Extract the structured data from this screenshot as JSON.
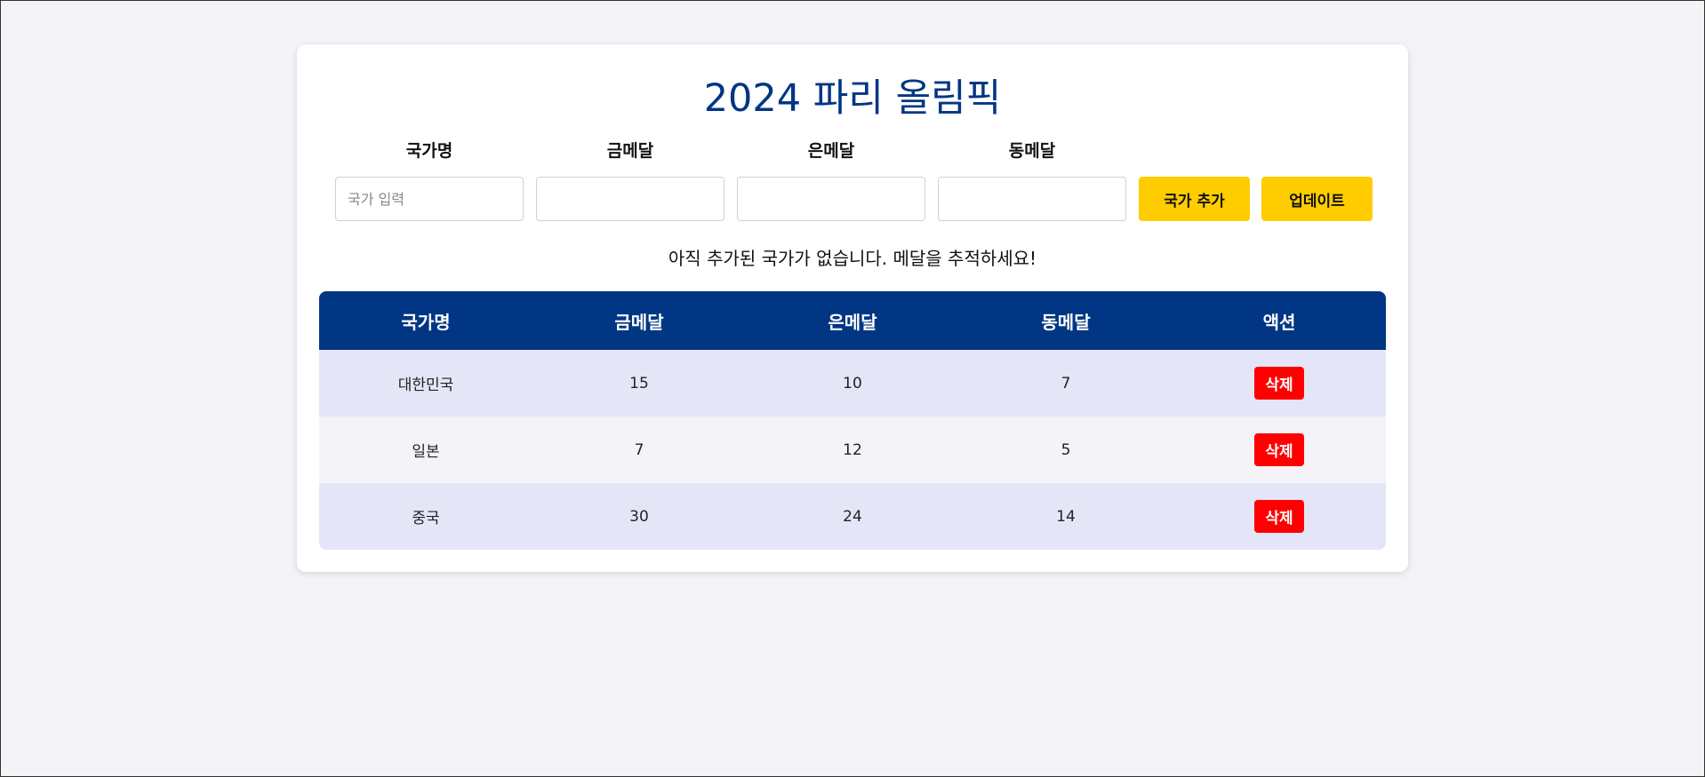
{
  "title": "2024 파리 올림픽",
  "form": {
    "country_label": "국가명",
    "country_placeholder": "국가 입력",
    "country_value": "",
    "gold_label": "금메달",
    "gold_value": "",
    "silver_label": "은메달",
    "silver_value": "",
    "bronze_label": "동메달",
    "bronze_value": "",
    "add_button_label": "국가 추가",
    "update_button_label": "업데이트"
  },
  "status_message": "아직 추가된 국가가 없습니다. 메달을 추적하세요!",
  "table": {
    "headers": [
      "국가명",
      "금메달",
      "은메달",
      "동메달",
      "액션"
    ],
    "rows": [
      {
        "country": "대한민국",
        "gold": "15",
        "silver": "10",
        "bronze": "7",
        "action_label": "삭제"
      },
      {
        "country": "일본",
        "gold": "7",
        "silver": "12",
        "bronze": "5",
        "action_label": "삭제"
      },
      {
        "country": "중국",
        "gold": "30",
        "silver": "24",
        "bronze": "14",
        "action_label": "삭제"
      }
    ]
  },
  "colors": {
    "title": "#003683",
    "header_bg": "#003683",
    "accent_button": "#ffcc00",
    "delete_button": "#ff0000",
    "row_odd": "#e4e6f8",
    "row_even": "#f3f3f8",
    "page_bg": "#f3f3f8"
  }
}
